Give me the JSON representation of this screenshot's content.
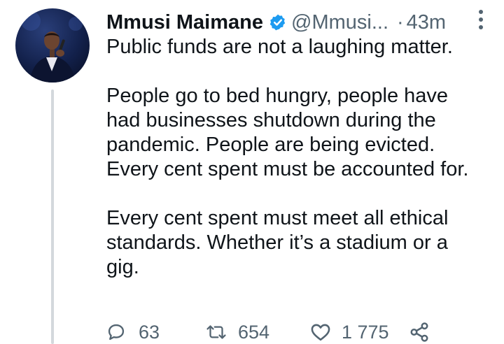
{
  "tweet": {
    "author_name": "Mmusi Maimane",
    "handle": "@Mmusi...",
    "separator": "·",
    "time_ago": "43m",
    "verified": true,
    "paragraphs": [
      [
        "Public funds are not a laughing matter."
      ],
      [
        "People go to bed hungry, people have",
        "had businesses shutdown during the",
        "pandemic. People are being evicted.",
        "Every cent spent must be accounted for."
      ],
      [
        "Every cent spent must meet all ethical",
        "standards. Whether it’s a stadium or a",
        "gig."
      ]
    ],
    "stats": {
      "replies": "63",
      "retweets": "654",
      "likes": "1 775"
    }
  },
  "icons": {
    "verified": "verified-badge-icon",
    "more": "more-vertical-icon",
    "reply": "reply-icon",
    "retweet": "retweet-icon",
    "like": "heart-icon",
    "share": "share-icon"
  },
  "colors": {
    "verified_blue": "#1d9bf0",
    "muted_text": "#536471",
    "thread_line": "#d3d8dc"
  }
}
